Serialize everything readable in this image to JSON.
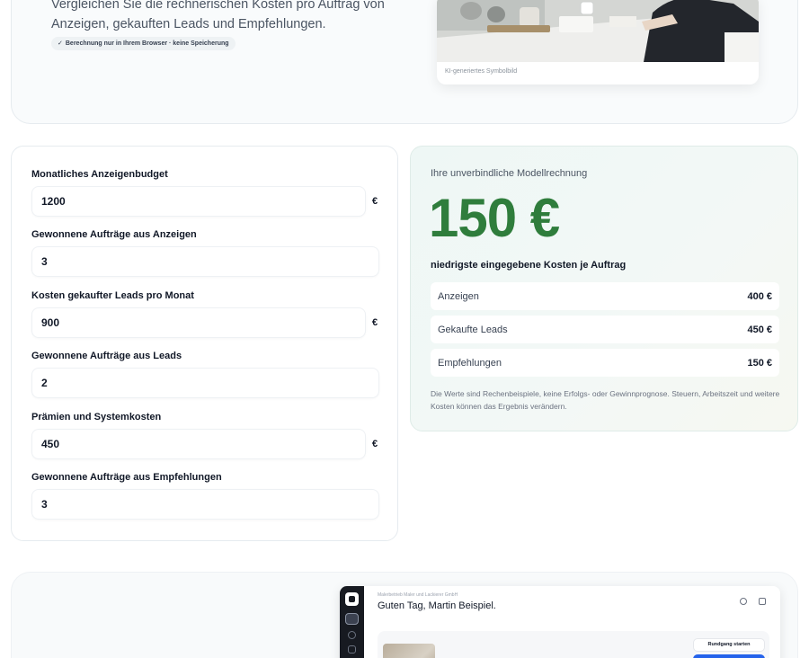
{
  "hero": {
    "description": "Vergleichen Sie die rechnerischen Kosten pro Auftrag von Anzeigen, gekauften Leads und Empfehlungen.",
    "privacy_note": "Berechnung nur in Ihrem Browser · keine Speicherung",
    "image_caption": "KI-generiertes Symbolbild",
    "check_icon": "check-icon"
  },
  "form": {
    "fields": [
      {
        "label": "Monatliches Anzeigenbudget",
        "value": "1200",
        "unit": "€"
      },
      {
        "label": "Gewonnene Aufträge aus Anzeigen",
        "value": "3",
        "unit": ""
      },
      {
        "label": "Kosten gekaufter Leads pro Monat",
        "value": "900",
        "unit": "€"
      },
      {
        "label": "Gewonnene Aufträge aus Leads",
        "value": "2",
        "unit": ""
      },
      {
        "label": "Prämien und Systemkosten",
        "value": "450",
        "unit": "€"
      },
      {
        "label": "Gewonnene Aufträge aus Empfehlungen",
        "value": "3",
        "unit": ""
      }
    ]
  },
  "result": {
    "kicker": "Ihre unverbindliche Modellrechnung",
    "value": "150 €",
    "subtitle": "niedrigste eingegebene Kosten je Auftrag",
    "rows": [
      {
        "label": "Anzeigen",
        "value": "400 €"
      },
      {
        "label": "Gekaufte Leads",
        "value": "450 €"
      },
      {
        "label": "Empfehlungen",
        "value": "150 €"
      }
    ],
    "disclaimer": "Die Werte sind Rechenbeispiele, keine Erfolgs- oder Gewinnprognose. Steuern, Arbeitszeit und weitere Kosten können das Ergebnis verändern.",
    "accent_color": "#2f7d3c"
  },
  "app_preview": {
    "company": "Malerbetrieb Maler und Lackierer GmbH",
    "greeting": "Guten Tag, Martin Beispiel.",
    "tour_button": "Rundgang starten",
    "primary_color": "#2563eb"
  }
}
